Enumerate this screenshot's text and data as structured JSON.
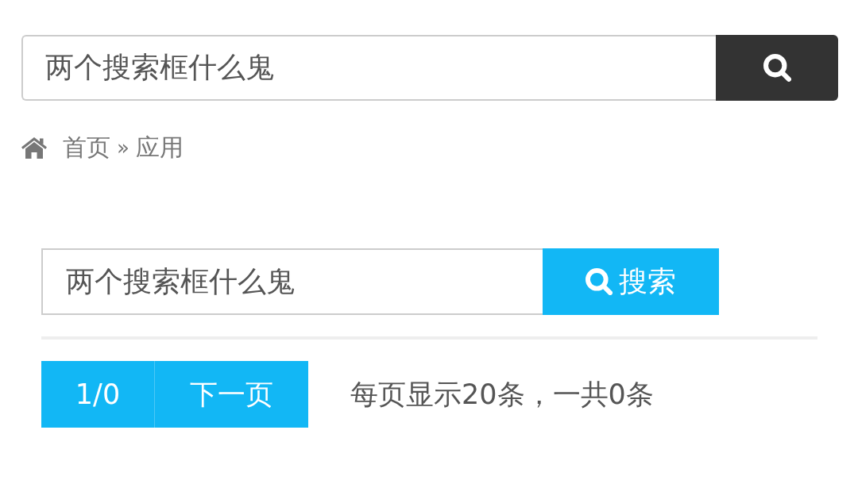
{
  "header_search": {
    "value": "两个搜索框什么鬼"
  },
  "breadcrumb": {
    "items": [
      {
        "label": "首页"
      },
      {
        "label": "应用"
      }
    ],
    "separator": "»"
  },
  "content_search": {
    "value": "两个搜索框什么鬼",
    "button": "搜索"
  },
  "pager": {
    "page_counter": "1/0",
    "next_button": "下一页",
    "summary": "每页显示20条，一共0条"
  }
}
